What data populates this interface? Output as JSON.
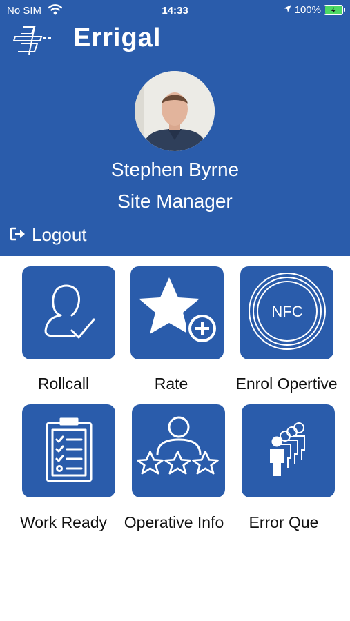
{
  "status_bar": {
    "carrier": "No SIM",
    "time": "14:33",
    "battery": "100%"
  },
  "header": {
    "brand": "Errigal",
    "user_name": "Stephen Byrne",
    "user_role": "Site Manager",
    "logout_label": "Logout"
  },
  "tiles": [
    {
      "label": "Rollcall",
      "icon": "person-check-icon"
    },
    {
      "label": "Rate",
      "icon": "star-plus-icon"
    },
    {
      "label": "Enrol Opertive",
      "icon": "nfc-icon",
      "icon_text": "NFC"
    },
    {
      "label": "Work Ready",
      "icon": "clipboard-checklist-icon"
    },
    {
      "label": "Operative Info",
      "icon": "person-stars-icon"
    },
    {
      "label": "Error Que",
      "icon": "people-queue-icon"
    }
  ],
  "colors": {
    "primary": "#2a5cab",
    "battery": "#4cd964"
  }
}
